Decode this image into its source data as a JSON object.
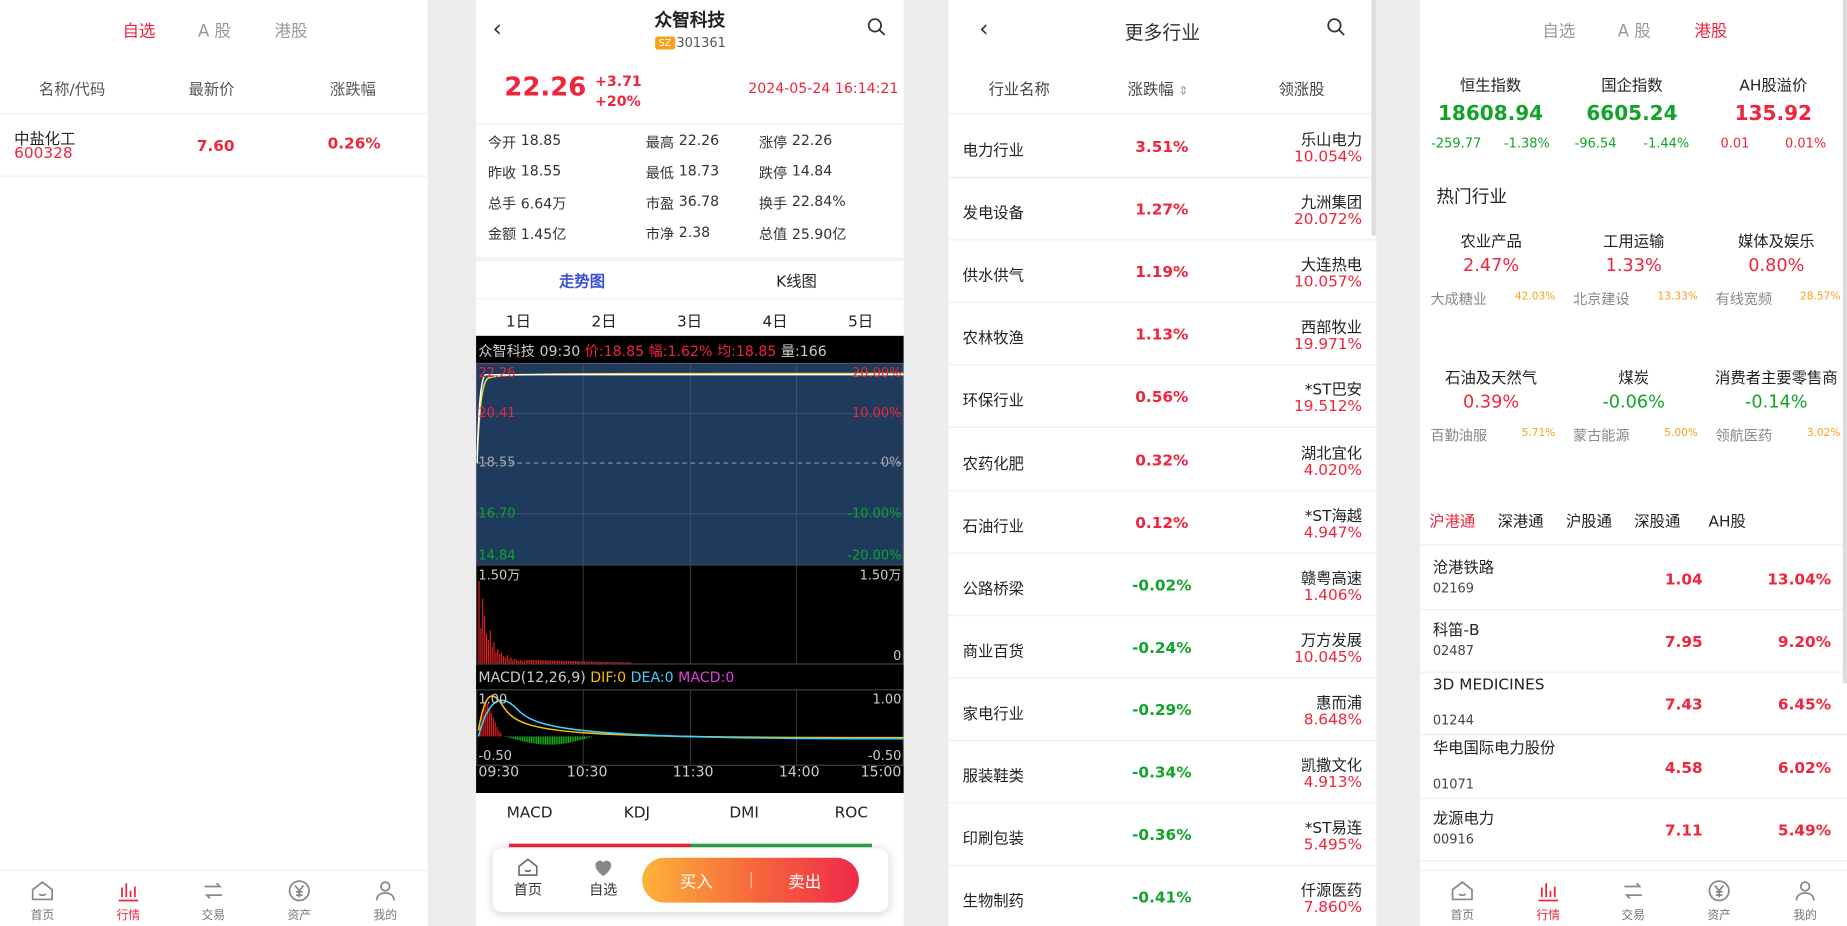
{
  "p1": {
    "tabs": [
      "自选",
      "A 股",
      "港股"
    ],
    "headers": [
      "名称/代码",
      "最新价",
      "涨跌幅"
    ],
    "row": {
      "name": "中盐化工",
      "code": "600328",
      "price": "7.60",
      "pct": "0.26%"
    }
  },
  "nav": [
    "首页",
    "行情",
    "交易",
    "资产",
    "我的"
  ],
  "p2": {
    "title": "众智科技",
    "market": "SZ",
    "code": "301361",
    "price": "22.26",
    "chg": "+3.71",
    "chgpct": "+20%",
    "time": "2024-05-24 16:14:21",
    "stats": [
      {
        "l": "今开",
        "v": "18.85",
        "c": "grn"
      },
      {
        "l": "最高",
        "v": "22.26",
        "c": "red"
      },
      {
        "l": "涨停",
        "v": "22.26",
        "c": "red"
      },
      {
        "l": "昨收",
        "v": "18.55",
        "c": ""
      },
      {
        "l": "最低",
        "v": "18.73",
        "c": "grn"
      },
      {
        "l": "跌停",
        "v": "14.84",
        "c": "grn"
      },
      {
        "l": "总手",
        "v": "6.64万",
        "c": ""
      },
      {
        "l": "市盈",
        "v": "36.78",
        "c": ""
      },
      {
        "l": "换手",
        "v": "22.84%",
        "c": ""
      },
      {
        "l": "金额",
        "v": "1.45亿",
        "c": ""
      },
      {
        "l": "市净",
        "v": "2.38",
        "c": ""
      },
      {
        "l": "总值",
        "v": "25.90亿",
        "c": ""
      }
    ],
    "tabs": [
      "走势图",
      "K线图"
    ],
    "days": [
      "1日",
      "2日",
      "3日",
      "4日",
      "5日"
    ],
    "info": {
      "name": "众智科技",
      "t": "09:30",
      "price": "价:18.85",
      "amp": "幅:1.62%",
      "avg": "均:18.85",
      "vol": "量:166"
    },
    "yl": [
      "22.26",
      "20.41",
      "18.55",
      "16.70",
      "14.84"
    ],
    "yr": [
      "20.00%",
      "10.00%",
      "0%",
      "-10.00%",
      "-20.00%"
    ],
    "vol": {
      "max": "1.50万",
      "min": "0"
    },
    "macd": {
      "label": "MACD(12,26,9)",
      "dif": "DIF:0",
      "dea": "DEA:0",
      "macd": "MACD:0",
      "top": "1.00",
      "bot": "-0.50"
    },
    "times": [
      "09:30",
      "10:30",
      "11:30",
      "14:00",
      "15:00"
    ],
    "ind": [
      "MACD",
      "KDJ",
      "DMI",
      "ROC"
    ],
    "buy": "买入",
    "sell": "卖出",
    "home": "首页",
    "fav": "自选"
  },
  "p3": {
    "title": "更多行业",
    "headers": [
      "行业名称",
      "涨跌幅",
      "领涨股"
    ],
    "rows": [
      {
        "n": "电力行业",
        "p": "3.51%",
        "l": "乐山电力",
        "lp": "10.054%",
        "c": "red"
      },
      {
        "n": "发电设备",
        "p": "1.27%",
        "l": "九洲集团",
        "lp": "20.072%",
        "c": "red"
      },
      {
        "n": "供水供气",
        "p": "1.19%",
        "l": "大连热电",
        "lp": "10.057%",
        "c": "red"
      },
      {
        "n": "农林牧渔",
        "p": "1.13%",
        "l": "西部牧业",
        "lp": "19.971%",
        "c": "red"
      },
      {
        "n": "环保行业",
        "p": "0.56%",
        "l": "*ST巴安",
        "lp": "19.512%",
        "c": "red"
      },
      {
        "n": "农药化肥",
        "p": "0.32%",
        "l": "湖北宜化",
        "lp": "4.020%",
        "c": "red"
      },
      {
        "n": "石油行业",
        "p": "0.12%",
        "l": "*ST海越",
        "lp": "4.947%",
        "c": "red"
      },
      {
        "n": "公路桥梁",
        "p": "-0.02%",
        "l": "赣粤高速",
        "lp": "1.406%",
        "c": "grn"
      },
      {
        "n": "商业百货",
        "p": "-0.24%",
        "l": "万方发展",
        "lp": "10.045%",
        "c": "grn"
      },
      {
        "n": "家电行业",
        "p": "-0.29%",
        "l": "惠而浦",
        "lp": "8.648%",
        "c": "grn"
      },
      {
        "n": "服装鞋类",
        "p": "-0.34%",
        "l": "凯撒文化",
        "lp": "4.913%",
        "c": "grn"
      },
      {
        "n": "印刷包装",
        "p": "-0.36%",
        "l": "*ST易连",
        "lp": "5.495%",
        "c": "grn"
      },
      {
        "n": "生物制药",
        "p": "-0.41%",
        "l": "仟源医药",
        "lp": "7.860%",
        "c": "grn"
      }
    ]
  },
  "p4": {
    "tabs": [
      "自选",
      "A 股",
      "港股"
    ],
    "idx": [
      {
        "n": "恒生指数",
        "v": "18608.94",
        "a": "-259.77",
        "p": "-1.38%",
        "c": "grn"
      },
      {
        "n": "国企指数",
        "v": "6605.24",
        "a": "-96.54",
        "p": "-1.44%",
        "c": "grn"
      },
      {
        "n": "AH股溢价",
        "v": "135.92",
        "a": "0.01",
        "p": "0.01%",
        "c": "red"
      }
    ],
    "hot": "热门行业",
    "sectors": [
      {
        "n": "农业产品",
        "p": "2.47%",
        "s": "大成糖业",
        "sp": "42.03%",
        "c": "red"
      },
      {
        "n": "工用运输",
        "p": "1.33%",
        "s": "北京建设",
        "sp": "13.33%",
        "c": "red"
      },
      {
        "n": "媒体及娱乐",
        "p": "0.80%",
        "s": "有线宽频",
        "sp": "28.57%",
        "c": "red"
      },
      {
        "n": "石油及天然气",
        "p": "0.39%",
        "s": "百勤油服",
        "sp": "5.71%",
        "c": "red"
      },
      {
        "n": "煤炭",
        "p": "-0.06%",
        "s": "蒙古能源",
        "sp": "5.00%",
        "c": "grn"
      },
      {
        "n": "消费者主要零售商",
        "p": "-0.14%",
        "s": "领航医药",
        "sp": "3.02%",
        "c": "grn"
      }
    ],
    "conn": [
      "沪港通",
      "深港通",
      "沪股通",
      "深股通",
      "AH股"
    ],
    "stocks": [
      {
        "n": "沧港铁路",
        "code": "02169",
        "p": "1.04",
        "c": "13.04%"
      },
      {
        "n": "科笛-B",
        "code": "02487",
        "p": "7.95",
        "c": "9.20%"
      },
      {
        "n": "3D MEDICINES",
        "code": "01244",
        "p": "7.43",
        "c": "6.45%"
      },
      {
        "n": "华电国际电力股份",
        "code": "01071",
        "p": "4.58",
        "c": "6.02%"
      },
      {
        "n": "龙源电力",
        "code": "00916",
        "p": "7.11",
        "c": "5.49%"
      }
    ]
  }
}
